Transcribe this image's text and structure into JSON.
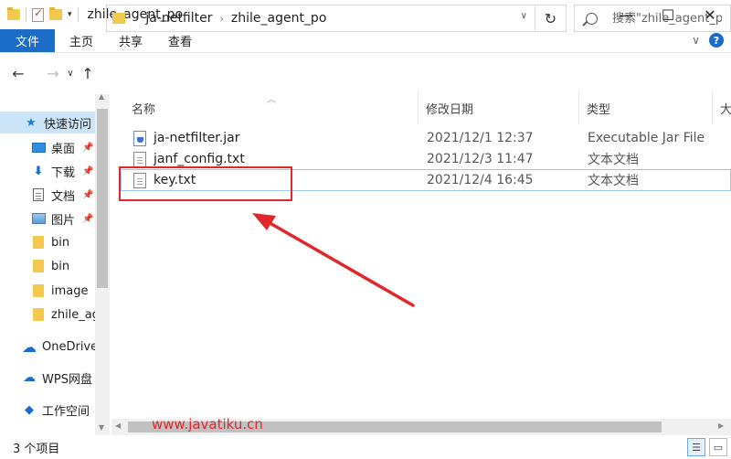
{
  "window": {
    "title": "zhile_agent_po",
    "controls": {
      "minimize": "—",
      "maximize": "☐",
      "close": "✕"
    }
  },
  "ribbon": {
    "tabs": [
      "文件",
      "主页",
      "共享",
      "查看"
    ],
    "collapse": "∨",
    "help": "?"
  },
  "nav": {
    "back": "←",
    "forward": "→",
    "recent": "∨",
    "up": "↑",
    "breadcrumb": [
      "ja-netfilter",
      "zhile_agent_po"
    ],
    "separator": "›",
    "dropdown": "∨",
    "refresh": "↻",
    "search_placeholder": "搜索\"zhile_agent_po\""
  },
  "sidebar": {
    "items": [
      {
        "label": "快速访问",
        "icon": "star-icon",
        "pinned": false,
        "active": true
      },
      {
        "label": "桌面",
        "icon": "desktop-icon",
        "pinned": true
      },
      {
        "label": "下载",
        "icon": "download-icon",
        "pinned": true
      },
      {
        "label": "文档",
        "icon": "document-icon",
        "pinned": true
      },
      {
        "label": "图片",
        "icon": "picture-icon",
        "pinned": true
      },
      {
        "label": "bin",
        "icon": "folder-icon",
        "pinned": false
      },
      {
        "label": "bin",
        "icon": "folder-icon",
        "pinned": false
      },
      {
        "label": "image",
        "icon": "folder-icon",
        "pinned": false
      },
      {
        "label": "zhile_agent_po",
        "icon": "folder-icon",
        "pinned": false
      },
      {
        "label": "OneDrive",
        "icon": "onedrive-icon",
        "pinned": false
      },
      {
        "label": "WPS网盘",
        "icon": "wps-cloud-icon",
        "pinned": false
      },
      {
        "label": "工作空间",
        "icon": "workspace-icon",
        "pinned": false
      }
    ],
    "pin_glyph": "📌"
  },
  "columns": {
    "name": "名称",
    "date": "修改日期",
    "type": "类型",
    "size": "大小"
  },
  "files": [
    {
      "name": "ja-netfilter.jar",
      "date": "2021/12/1 12:37",
      "type": "Executable Jar File",
      "icon": "jar-file-icon"
    },
    {
      "name": "janf_config.txt",
      "date": "2021/12/3 11:47",
      "type": "文本文档",
      "icon": "text-file-icon"
    },
    {
      "name": "key.txt",
      "date": "2021/12/4 16:45",
      "type": "文本文档",
      "icon": "text-file-icon"
    }
  ],
  "status": {
    "count": "3 个项目"
  },
  "watermark": "www.javatiku.cn",
  "colors": {
    "accent": "#1a6cc7",
    "annotation": "#e0282b",
    "selection": "#cce4f7"
  }
}
